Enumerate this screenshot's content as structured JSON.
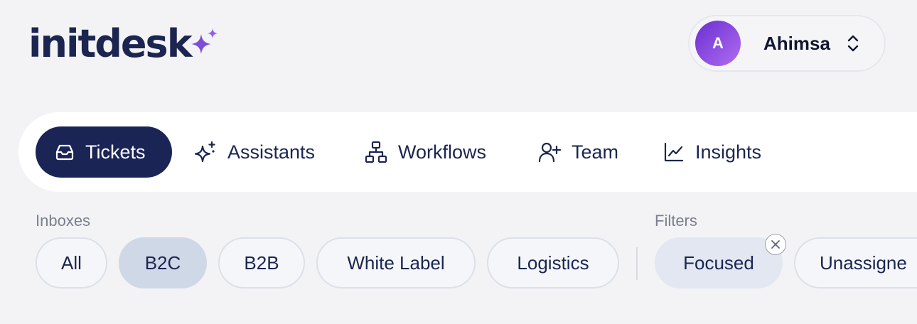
{
  "brand": {
    "name": "initdesk"
  },
  "user": {
    "initial": "A",
    "name": "Ahimsa"
  },
  "nav": {
    "tickets": "Tickets",
    "assistants": "Assistants",
    "workflows": "Workflows",
    "team": "Team",
    "insights": "Insights"
  },
  "inboxes": {
    "label": "Inboxes",
    "items": [
      "All",
      "B2C",
      "B2B",
      "White Label",
      "Logistics"
    ],
    "selected": "B2C"
  },
  "filters": {
    "label": "Filters",
    "items": [
      "Focused",
      "Unassigne"
    ],
    "active": "Focused"
  },
  "colors": {
    "navy": "#1a2455",
    "background": "#f3f3f6",
    "accent_purple": "#7b4fd6",
    "selected_chip": "#cfd8e6"
  },
  "icons": {
    "tickets": "inbox-tray-icon",
    "assistants": "sparkles-icon",
    "workflows": "hierarchy-icon",
    "team": "user-plus-icon",
    "insights": "line-chart-icon",
    "user_switch": "chevron-up-down-icon",
    "filter_clear": "close-icon"
  }
}
